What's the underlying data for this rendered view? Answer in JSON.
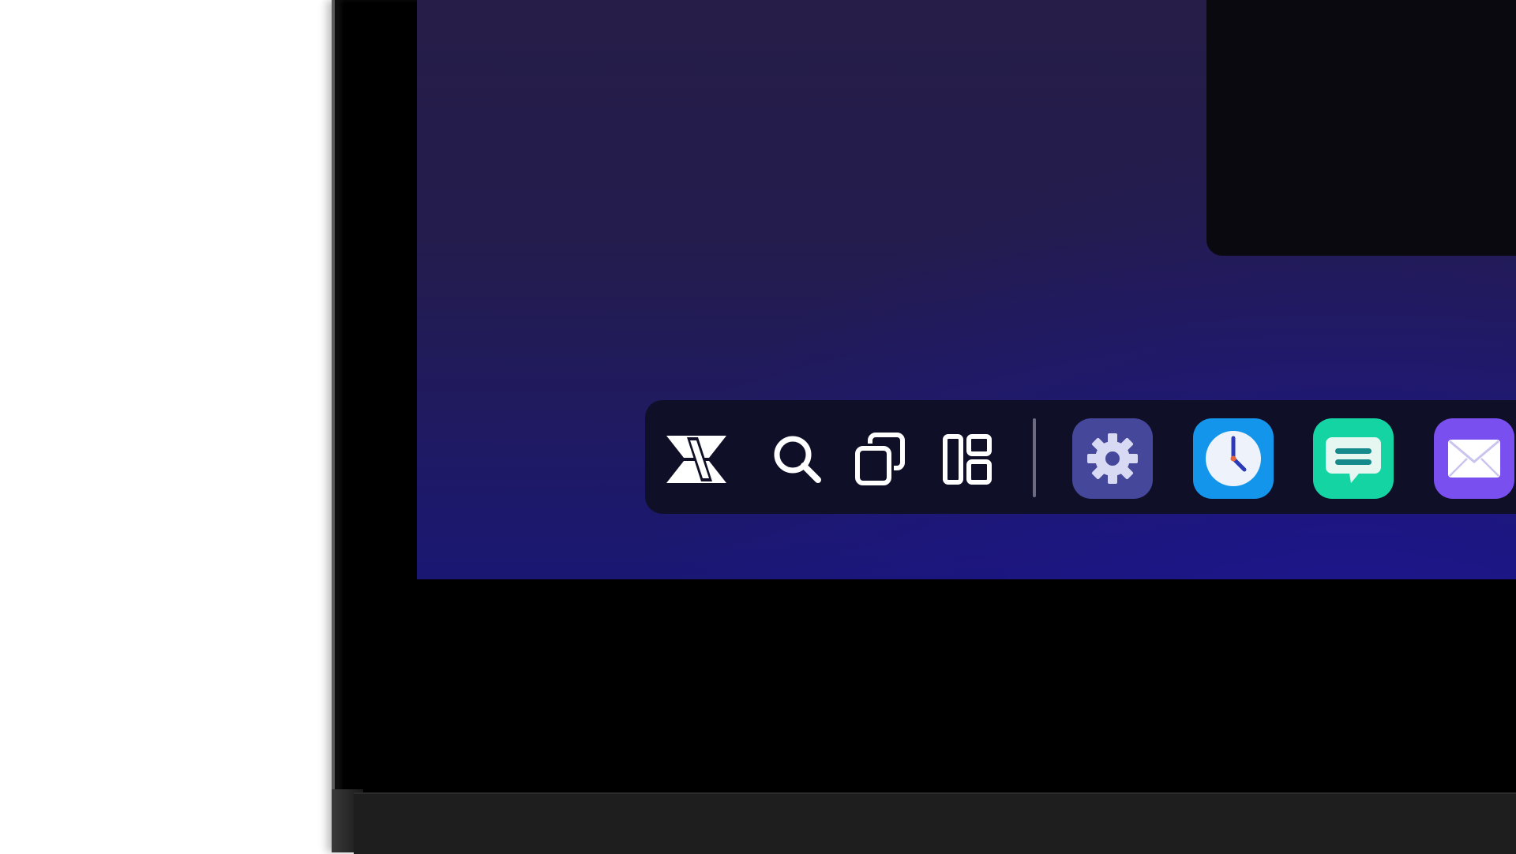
{
  "theme": {
    "desktop_gradient_top": "#261d48",
    "desktop_gradient_bottom": "#1a1773",
    "taskbar_bg": "#100f28"
  },
  "taskbar": {
    "system_icons": [
      "launcher-logo-icon",
      "search-icon",
      "windows-overview-icon",
      "virtual-desks-icon"
    ],
    "apps": [
      {
        "name": "settings",
        "icon": "gear-icon",
        "color": "#45479a"
      },
      {
        "name": "clock",
        "icon": "clock-icon",
        "color": "#1495ec"
      },
      {
        "name": "messages",
        "icon": "chat-bubble-icon",
        "color": "#14d4a4"
      },
      {
        "name": "mail",
        "icon": "envelope-icon",
        "color": "#7a4ff0"
      }
    ]
  }
}
